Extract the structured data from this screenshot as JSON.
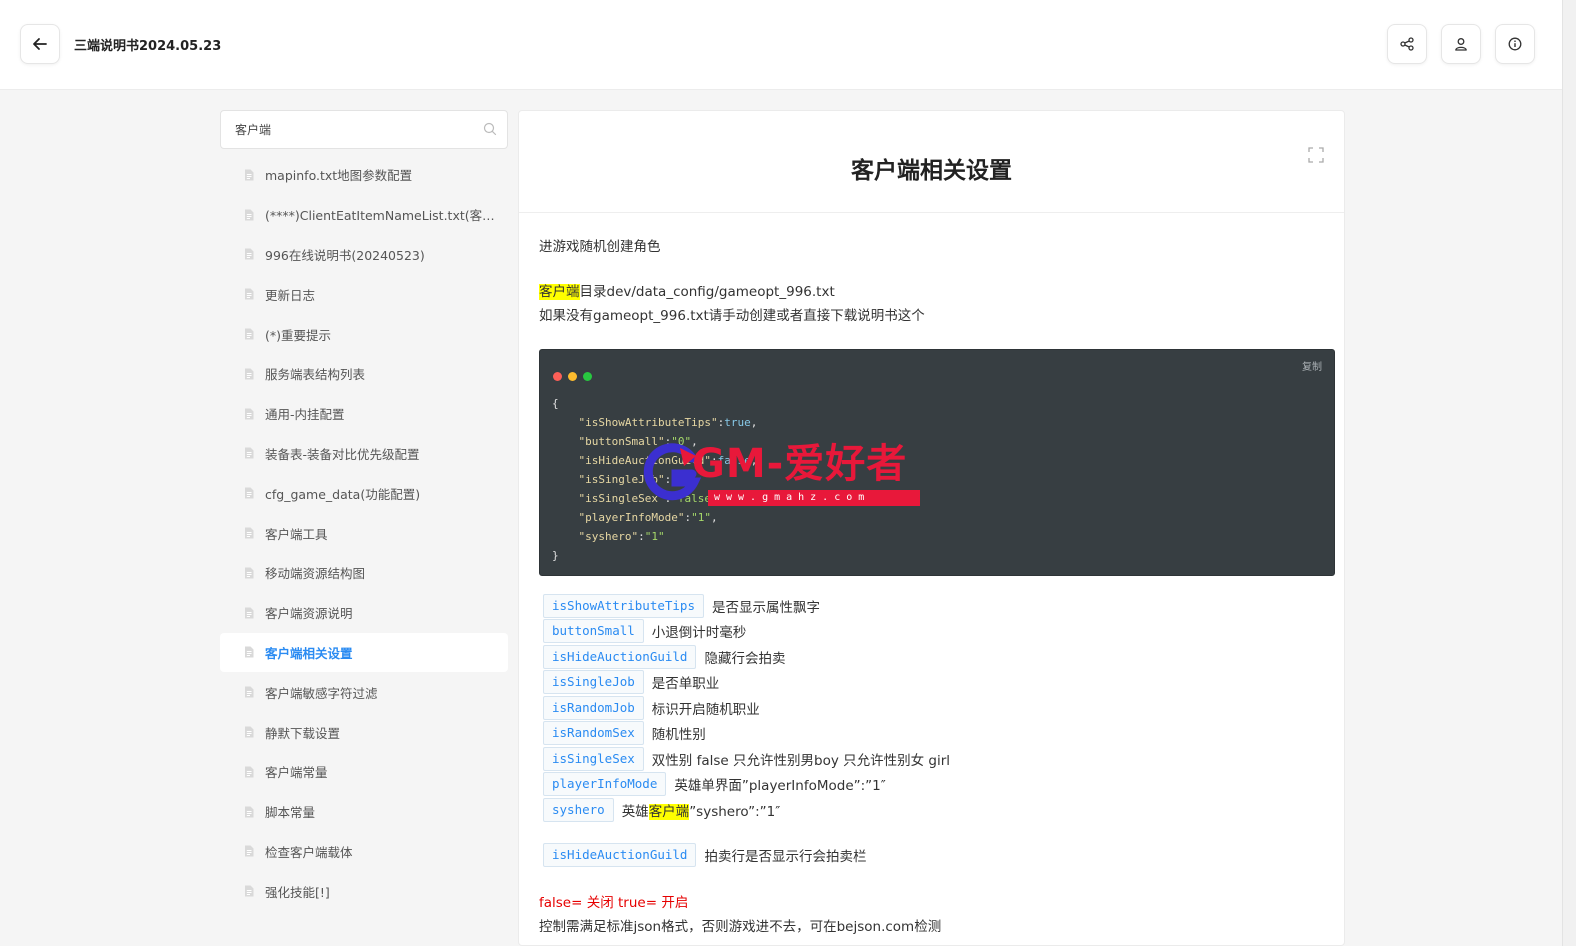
{
  "header": {
    "doc_title": "三端说明书2024.05.23",
    "back_icon": "arrow-left-icon",
    "share_icon": "share-icon",
    "user_icon": "user-icon",
    "info_icon": "info-icon"
  },
  "sidebar": {
    "search": {
      "value": "客户端",
      "placeholder": ""
    },
    "active_index": 12,
    "items": [
      {
        "label": "mapinfo.txt地图参数配置"
      },
      {
        "label": "(****)ClientEatItemNameList.txt(客户..."
      },
      {
        "label": "996在线说明书(20240523)"
      },
      {
        "label": "更新日志"
      },
      {
        "label": "(*)重要提示"
      },
      {
        "label": "服务端表结构列表"
      },
      {
        "label": "通用-内挂配置"
      },
      {
        "label": "装备表-装备对比优先级配置"
      },
      {
        "label": "cfg_game_data(功能配置)"
      },
      {
        "label": "客户端工具"
      },
      {
        "label": "移动端资源结构图"
      },
      {
        "label": "客户端资源说明"
      },
      {
        "label": "客户端相关设置"
      },
      {
        "label": "客户端敏感字符过滤"
      },
      {
        "label": "静默下载设置"
      },
      {
        "label": "客户端常量"
      },
      {
        "label": "脚本常量"
      },
      {
        "label": "检查客户端载体"
      },
      {
        "label": "强化技能[!]"
      }
    ]
  },
  "content": {
    "title": "客户端相关设置",
    "intro": "进游戏随机创建角色",
    "path_highlight": "客户端",
    "path_rest": "目录dev/data_config/gameopt_996.txt",
    "missing_note": "如果没有gameopt_996.txt请手动创建或者直接下载说明书这个",
    "code": {
      "copy_label": "复制",
      "open": "{",
      "close": "}",
      "lines": [
        {
          "key": "\"isShowAttributeTips\"",
          "value": "true",
          "type": "v"
        },
        {
          "key": "\"buttonSmall\"",
          "value": "\"0\"",
          "type": "s"
        },
        {
          "key": "\"isHideAuctionGuild\"",
          "value": "false",
          "type": "v"
        },
        {
          "key": "\"isSingleJob\"",
          "value": "\"0\"",
          "type": "s"
        },
        {
          "key": "\"isSingleSex\"",
          "value": "\"false\"",
          "type": "s"
        },
        {
          "key": "\"playerInfoMode\"",
          "value": "\"1\"",
          "type": "s"
        },
        {
          "key": "\"syshero\"",
          "value": "\"1\"",
          "type": "s"
        }
      ]
    },
    "params": [
      {
        "tag": "isShowAttributeTips",
        "desc": "是否显示属性飘字"
      },
      {
        "tag": "buttonSmall",
        "desc": "小退倒计时毫秒"
      },
      {
        "tag": "isHideAuctionGuild",
        "desc": "隐藏行会拍卖"
      },
      {
        "tag": "isSingleJob",
        "desc": "是否单职业"
      },
      {
        "tag": "isRandomJob",
        "desc": "标识开启随机职业"
      },
      {
        "tag": "isRandomSex",
        "desc": "随机性别"
      },
      {
        "tag": "isSingleSex",
        "desc": "双性别 false 只允许性别男boy 只允许性别女 girl"
      },
      {
        "tag": "playerInfoMode",
        "desc": "英雄单界面”playerInfoMode”:”1″"
      },
      {
        "tag": "syshero",
        "desc_pre": "英雄",
        "desc_hl": "客户端",
        "desc_post": "”syshero”:”1″"
      }
    ],
    "auction_param": {
      "tag": "isHideAuctionGuild",
      "desc": "拍卖行是否显示行会拍卖栏"
    },
    "bool_note": "false= 关闭 true= 开启",
    "json_note": "控制需满足标准json格式，否则游戏进不去，可在bejson.com检测"
  },
  "watermark": {
    "brand": "GM-爱好者",
    "url": "www.gmahz.com"
  },
  "colors": {
    "accent": "#2a8bf2",
    "highlight": "#ffff00",
    "code_bg": "#373e42",
    "red_note": "#e60000",
    "watermark_red": "#e8183a"
  }
}
